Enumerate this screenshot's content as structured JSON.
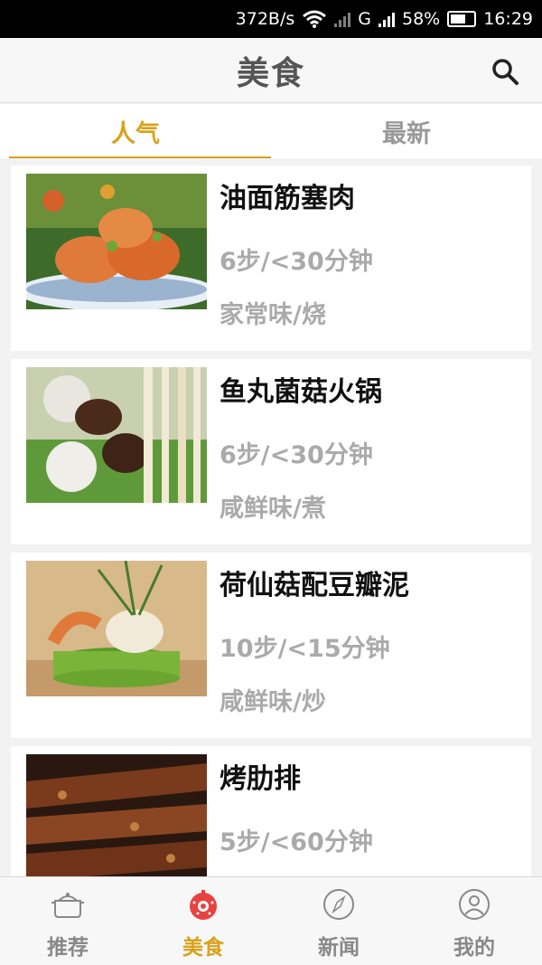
{
  "status_bar": {
    "speed": "372B/s",
    "network": "G",
    "battery": "58%",
    "time": "16:29"
  },
  "header": {
    "title": "美食",
    "search_icon": "search-icon"
  },
  "tabs": [
    {
      "label": "人气",
      "active": true
    },
    {
      "label": "最新",
      "active": false
    }
  ],
  "recipes": [
    {
      "name": "油面筋塞肉",
      "steps": "6步/<30分钟",
      "flavor": "家常味/烧"
    },
    {
      "name": "鱼丸菌菇火锅",
      "steps": "6步/<30分钟",
      "flavor": "咸鲜味/煮"
    },
    {
      "name": "荷仙菇配豆瓣泥",
      "steps": "10步/<15分钟",
      "flavor": "咸鲜味/炒"
    },
    {
      "name": "烤肋排",
      "steps": "5步/<60分钟",
      "flavor": ""
    }
  ],
  "bottom_nav": [
    {
      "label": "推荐",
      "icon": "pot-icon",
      "active": false
    },
    {
      "label": "美食",
      "icon": "food-icon",
      "active": true
    },
    {
      "label": "新闻",
      "icon": "compass-icon",
      "active": false
    },
    {
      "label": "我的",
      "icon": "user-icon",
      "active": false
    }
  ],
  "colors": {
    "accent": "#d9a21c",
    "active_icon": "#e8423f",
    "muted_text": "#aaaaaa"
  }
}
